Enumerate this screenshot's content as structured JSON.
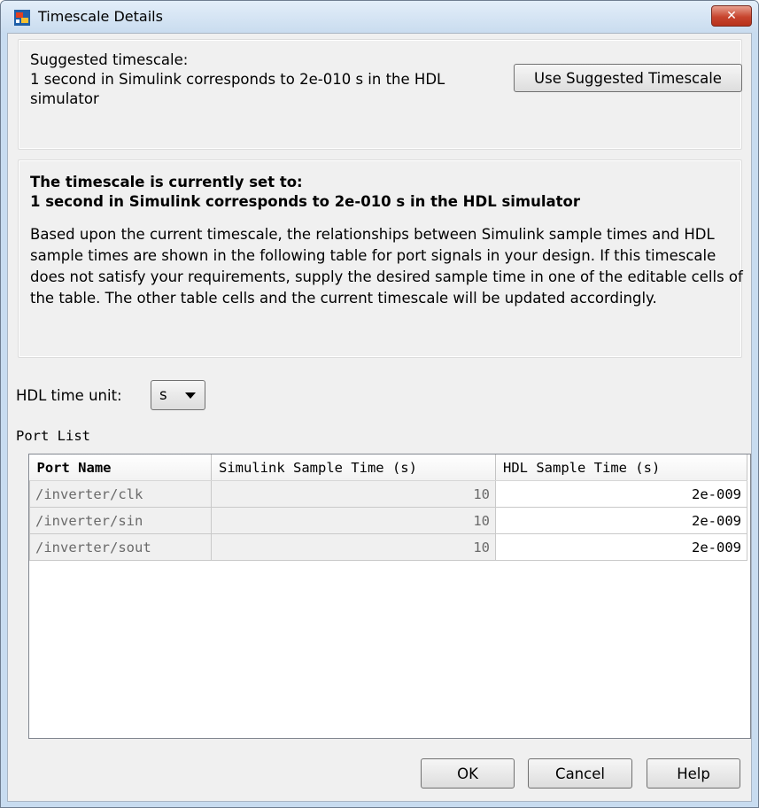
{
  "window": {
    "title": "Timescale Details",
    "close_label": "✕"
  },
  "suggested": {
    "line1": "Suggested timescale:",
    "line2": "1 second in Simulink corresponds to 2e-010 s in the HDL simulator",
    "button_label": "Use Suggested Timescale"
  },
  "current": {
    "head1": "The timescale is currently set to:",
    "head2": "1 second in Simulink corresponds to 2e-010 s in the HDL simulator",
    "body": "Based upon the current timescale, the relationships between Simulink sample times and HDL sample times are shown in the following table for port signals in your design. If this timescale does not satisfy your requirements, supply the desired sample time in one of the editable cells of the table. The other table cells and the current timescale will be updated accordingly."
  },
  "hdl_unit": {
    "label": "HDL time unit:",
    "value": "s"
  },
  "port_list": {
    "label": "Port List",
    "columns": [
      "Port Name",
      "Simulink Sample Time (s)",
      "HDL Sample Time (s)"
    ],
    "rows": [
      {
        "port": "/inverter/clk",
        "simulink": "10",
        "hdl": "2e-009"
      },
      {
        "port": "/inverter/sin",
        "simulink": "10",
        "hdl": "2e-009"
      },
      {
        "port": "/inverter/sout",
        "simulink": "10",
        "hdl": "2e-009"
      }
    ]
  },
  "footer": {
    "ok": "OK",
    "cancel": "Cancel",
    "help": "Help"
  },
  "colors": {
    "title_bar": "#c9dcef",
    "close_button": "#c7452e",
    "dialog_bg": "#f0f0f0"
  },
  "icons": {
    "app": "simulink-app-icon",
    "close": "close-icon",
    "dropdown": "chevron-down-icon"
  }
}
